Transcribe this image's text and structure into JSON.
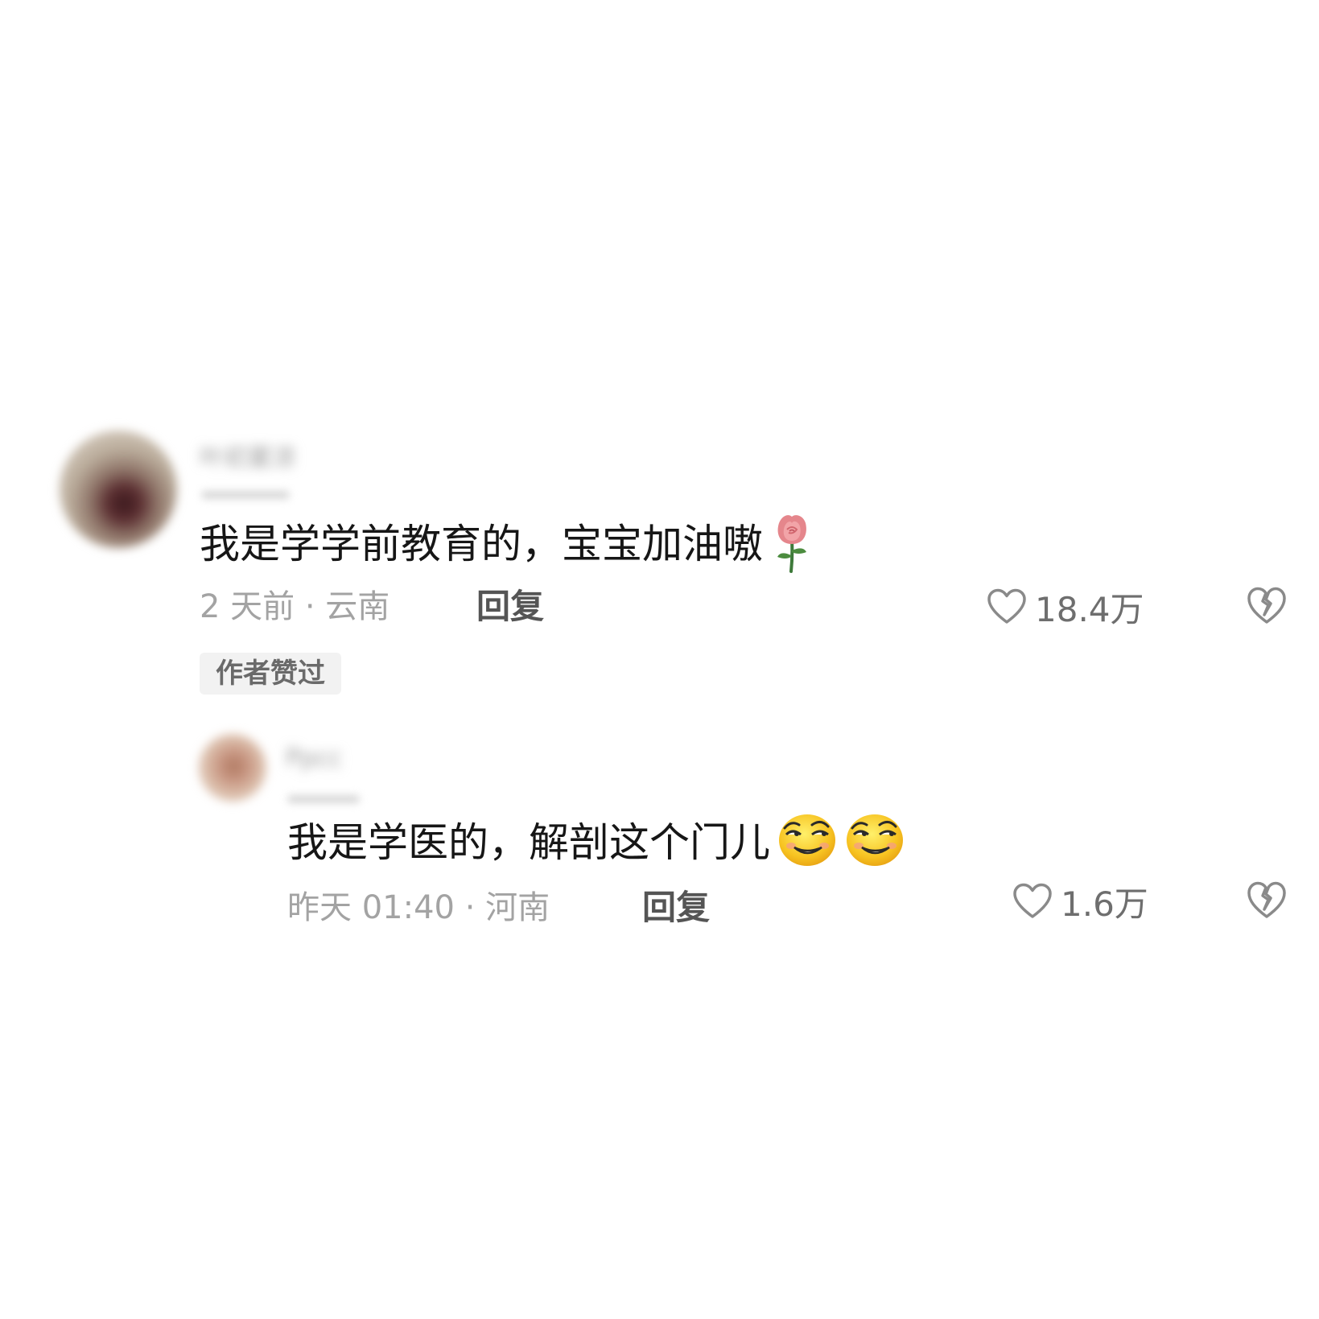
{
  "comment": {
    "avatar_icon": "user-avatar",
    "username": "叶初夏凉",
    "text": "我是学学前教育的，宝宝加油嗷",
    "emoji": "rose-emoji",
    "meta": "2 天前 · 云南",
    "reply_label": "回复",
    "like_count": "18.4万",
    "author_liked_badge": "作者赞过"
  },
  "reply": {
    "avatar_icon": "user-avatar",
    "username": "Ppcc",
    "text": "我是学医的，解剖这个门儿",
    "emoji": "smirk-emoji",
    "emoji_count": 2,
    "meta": "昨天 01:40 · 河南",
    "reply_label": "回复",
    "like_count": "1.6万"
  },
  "colors": {
    "background": "#ffffff",
    "text_primary": "#161616",
    "text_meta": "#a3a3a3",
    "reply_button": "#555555",
    "badge_bg": "#f2f2f2"
  }
}
